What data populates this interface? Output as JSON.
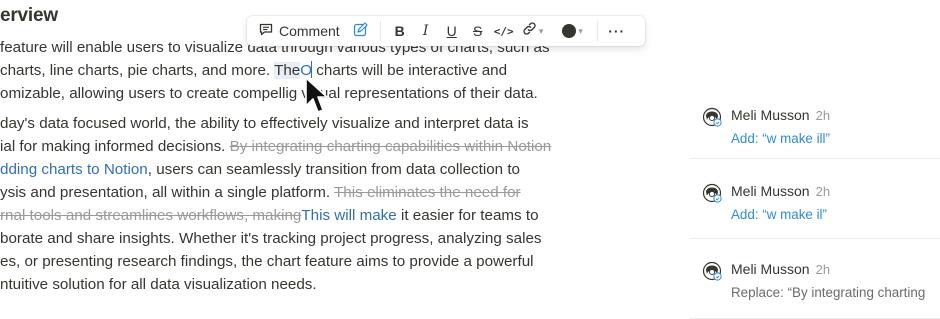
{
  "doc": {
    "heading": "erview",
    "p1": {
      "l1": "feature will enable users to visualize data through various types of charts, such as",
      "l2a": "charts, line charts, pie charts, and more. ",
      "l2sel": "The",
      "l2ins": "O",
      "l2b": " charts will be interactive and",
      "l3a": "omizable, allowing users to create compelli",
      "l3b": "g visual representations of their data."
    },
    "p2": {
      "l1": "day's data focused world, the ability to effectively visualize and interpret data is",
      "l2a": "ial for making informed decisions. ",
      "l2strike": "By integrating charting capabilities within Notion",
      "l3link": "dding charts to Notion",
      "l3b": ", users can seamlessly transition from data collection to",
      "l4a": "ysis and presentation, all within a single platform. ",
      "l4strike": "This eliminates the need for",
      "l5strike": "rnal tools and streamlines workflows, making",
      "l5ins": "This will make",
      "l5b": "  it easier for teams to",
      "l6": "borate and share insights. Whether it's tracking project progress, analyzing sales",
      "l7": "es, or presenting research findings, the chart feature aims to provide a powerful",
      "l8": "ntuitive solution for all data visualization needs."
    }
  },
  "toolbar": {
    "comment_label": "Comment",
    "bold": "B",
    "italic": "I",
    "underline": "U",
    "strike": "S",
    "code": "</>",
    "link": "🔗",
    "more": "···"
  },
  "comments": [
    {
      "author": "Meli Musson",
      "time": "2h",
      "text": "Add: “w make ill”",
      "style": "blue"
    },
    {
      "author": "Meli Musson",
      "time": "2h",
      "text": "Add: “w make il”",
      "style": "blue"
    },
    {
      "author": "Meli Musson",
      "time": "2h",
      "text": "Replace: “By integrating charting",
      "style": "gray"
    }
  ]
}
